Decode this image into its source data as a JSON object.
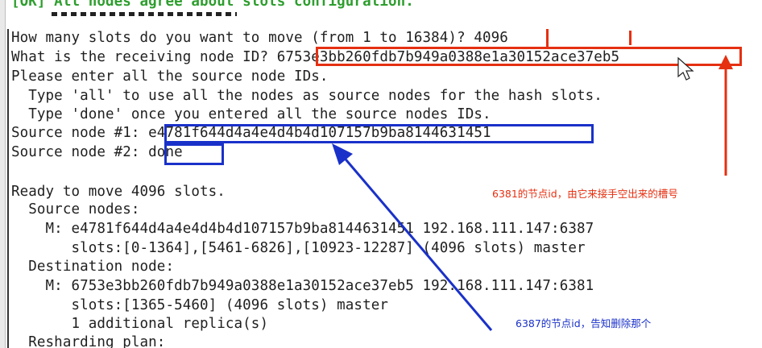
{
  "status_line": "[OK] All nodes agree about slots configuration.",
  "lines": [
    "How many slots do you want to move (from 1 to 16384)? 4096",
    "What is the receiving node ID? 6753e3bb260fdb7b949a0388e1a30152ace37eb5",
    "Please enter all the source node IDs.",
    "  Type 'all' to use all the nodes as source nodes for the hash slots.",
    "  Type 'done' once you entered all the source nodes IDs.",
    "Source node #1: e4781f644d4a4e4d4b4d107157b9ba8144631451",
    "Source node #2: done",
    "",
    "Ready to move 4096 slots.",
    "  Source nodes:",
    "    M: e4781f644d4a4e4d4b4d107157b9ba8144631451 192.168.111.147:6387",
    "       slots:[0-1364],[5461-6826],[10923-12287] (4096 slots) master",
    "  Destination node:",
    "    M: 6753e3bb260fdb7b949a0388e1a30152ace37eb5 192.168.111.147:6381",
    "       slots:[1365-5460] (4096 slots) master",
    "       1 additional replica(s)",
    "  Resharding plan:"
  ],
  "annotations": {
    "receiving_node": "6381的节点id，由它来接手空出来的槽号",
    "source_node": "6387的节点id，告知删除那个"
  },
  "colors": {
    "red": "#e53012",
    "blue": "#1a31c9",
    "ok_green": "#2e9e2e"
  },
  "icons": [
    "mouse-cursor-icon"
  ]
}
